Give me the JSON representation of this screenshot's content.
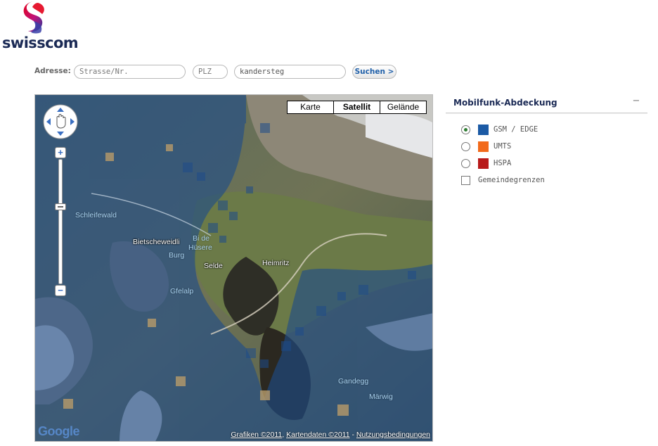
{
  "header": {
    "logo_text": "swisscom"
  },
  "search": {
    "label": "Adresse:",
    "street_value": "Strasse/Nr.",
    "plz_value": "PLZ",
    "city_value": "kandersteg",
    "button_label": "Suchen >"
  },
  "map": {
    "map_types": [
      {
        "label": "Karte",
        "active": false
      },
      {
        "label": "Satellit",
        "active": true
      },
      {
        "label": "Gelände",
        "active": false
      }
    ],
    "zoom_in": "+",
    "zoom_out": "−",
    "places": {
      "schleifewald": "Schleifewald",
      "bietscheweidli": "Bietscheweidli",
      "bi_de": "Bi de",
      "husere": "Hüsere",
      "burg": "Burg",
      "selde": "Selde",
      "heimritz": "Heimritz",
      "gfelalp": "Gfelalp",
      "gandegg": "Gandegg",
      "marwig": "Märwig"
    },
    "google_logo": "Google",
    "attribution": {
      "grafiken": "Grafiken ©2011",
      "kartendaten": "Kartendaten ©2011",
      "separator": "-",
      "nutzung": "Nutzungsbedingungen"
    }
  },
  "legend": {
    "title": "Mobilfunk-Abdeckung",
    "collapse_symbol": "−",
    "items": [
      {
        "label": "GSM / EDGE",
        "color": "#1b5aa5",
        "selected": true
      },
      {
        "label": "UMTS",
        "color": "#f26a1b",
        "selected": false
      },
      {
        "label": "HSPA",
        "color": "#b81a1a",
        "selected": false
      }
    ],
    "boundaries_label": "Gemeindegrenzen",
    "boundaries_checked": false
  },
  "colors": {
    "brand_navy": "#1b2a55",
    "link_blue": "#1f5fa8",
    "coverage_overlay": "#1e4c8a"
  }
}
